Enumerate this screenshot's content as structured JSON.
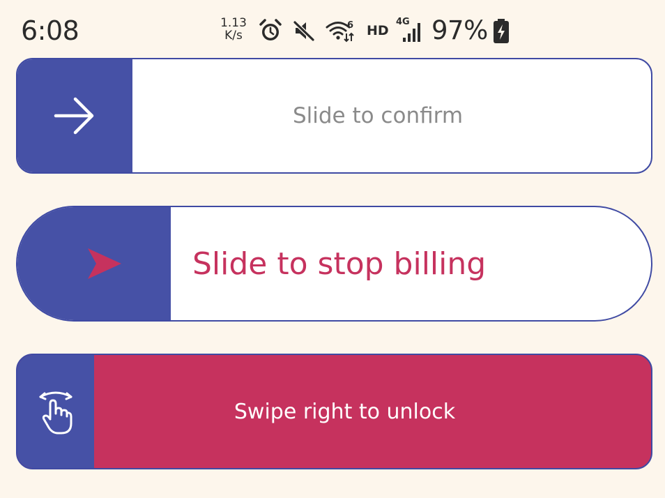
{
  "status_bar": {
    "time": "6:08",
    "net_speed_value": "1.13",
    "net_speed_unit": "K/s",
    "icons": [
      "alarm-icon",
      "mute-icon",
      "wifi-6-icon",
      "hd-icon",
      "4g-signal-icon",
      "battery-charging-icon"
    ],
    "hd_label": "HD",
    "network_label": "4G",
    "battery_percent": "97%"
  },
  "sliders": [
    {
      "label": "Slide to confirm",
      "knob_icon": "arrow-right-icon",
      "track_color": "#ffffff",
      "knob_color": "#4651a6",
      "text_color": "#8a8a8a"
    },
    {
      "label": "Slide to stop billing",
      "knob_icon": "navigation-arrow-icon",
      "track_color": "#ffffff",
      "knob_color": "#4651a6",
      "text_color": "#c6325e"
    },
    {
      "label": "Swipe right to unlock",
      "knob_icon": "swipe-hand-icon",
      "track_color": "#c6325e",
      "knob_color": "#4651a6",
      "text_color": "#ffffff"
    }
  ],
  "colors": {
    "background": "#fdf6ec",
    "accent_blue": "#4651a6",
    "accent_pink": "#c6325e"
  }
}
